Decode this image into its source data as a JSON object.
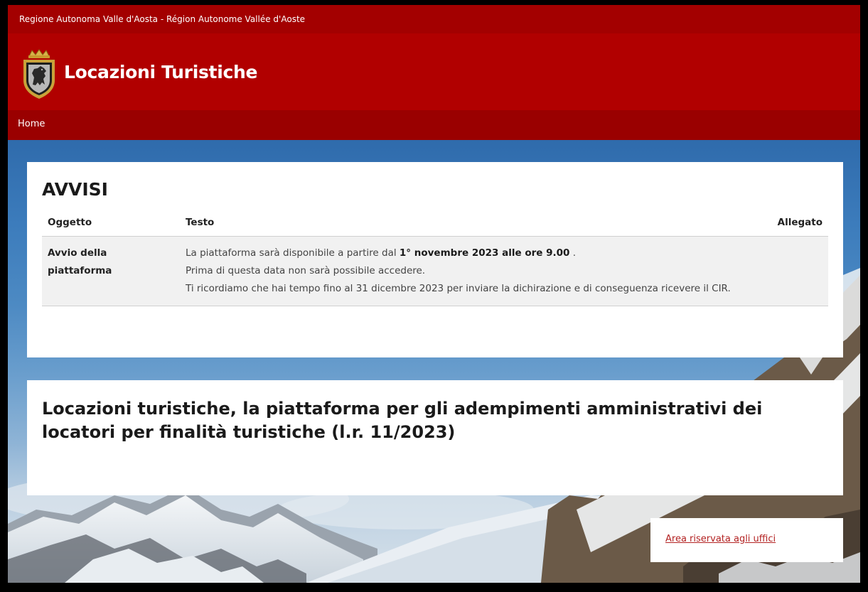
{
  "topbar": {
    "region": "Regione Autonoma Valle d'Aosta - Région Autonome Vallée d'Aoste"
  },
  "header": {
    "title": "Locazioni Turistiche",
    "crest_icon": "coat-of-arms-icon"
  },
  "nav": {
    "home": "Home"
  },
  "avvisi": {
    "title": "AVVISI",
    "columns": [
      "Oggetto",
      "Testo",
      "Allegato"
    ],
    "rows": [
      {
        "oggetto": "Avvio della piattaforma",
        "line1_pre": "La piattaforma sarà disponibile a partire dal",
        "line1_bold": "1° novembre 2023 alle ore 9.00",
        "line1_post": ".",
        "line2": "Prima di questa data non sarà possibile accedere.",
        "line3": "Ti ricordiamo che hai tempo fino al 31 dicembre 2023 per inviare la dichirazione e di conseguenza ricevere il CIR.",
        "allegato": ""
      }
    ]
  },
  "intro": {
    "title": "Locazioni turistiche, la piattaforma per gli adempimenti amministrativi dei locatori per finalità turistiche (l.r. 11/2023)"
  },
  "area": {
    "link": "Area riservata agli uffici"
  },
  "colors": {
    "topbar": "#a30000",
    "header": "#b10000",
    "navbar": "#9a0000",
    "link": "#b32222"
  }
}
